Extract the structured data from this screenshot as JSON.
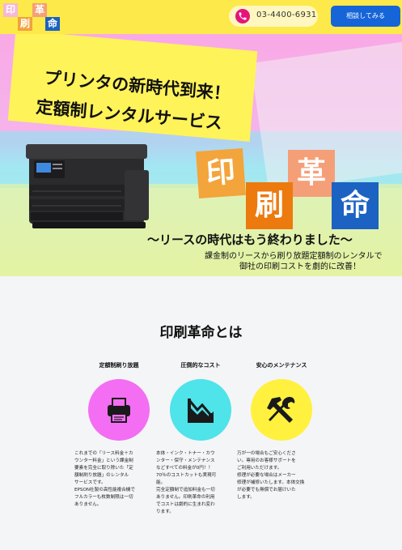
{
  "header": {
    "logo": {
      "chars": [
        "印",
        "革",
        "刷",
        "命"
      ],
      "colors": [
        "#f5b8d8",
        "#f59f78",
        "#f1a23b",
        "#1b62c2"
      ]
    },
    "phone": {
      "number": "03-4400-6931",
      "icon": "phone-icon"
    },
    "contact_label": "相談してみる"
  },
  "hero": {
    "title_line1": "プリンタの新時代到来！",
    "title_line2": "定額制レンタルサービス",
    "tiles": [
      "印",
      "革",
      "刷",
      "命"
    ],
    "tile_colors": [
      "#f3a43b",
      "#f59f78",
      "#ec7a0e",
      "#1b62c2"
    ],
    "tagline": "〜リースの時代はもう終わりました〜",
    "desc_line1": "課金制のリースから刷り放題定額制のレンタルで",
    "desc_line2": "御社の印刷コストを劇的に改善！"
  },
  "about": {
    "title": "印刷革命とは",
    "features": [
      {
        "title": "定額制刷り放題",
        "icon": "printer-icon",
        "color": "#f36ef3",
        "text": [
          "これまでの「リース料金＋カ",
          "ウンター料金」という課金制",
          "要素を完全に取り除いた「定",
          "額制刷り放題」のレンタル",
          "サービスです。",
          "EPSON社製の高性能複合機で",
          "フルカラーも枚数制限は一切",
          "ありません。"
        ]
      },
      {
        "title": "圧倒的なコスト",
        "icon": "cost-down-chart-icon",
        "color": "#4fe3ea",
        "text": [
          "本体・インク・トナー・カウ",
          "ンター・保守・メンテナンス",
          "などすべての料金が0円！！",
          "70％のコストカットも実現可",
          "能。",
          "完全定額制で追加料金も一切",
          "ありません。印刷革命の利用",
          "でコストは劇的に生まれ変わ",
          "ります。"
        ]
      },
      {
        "title": "安心のメンテナンス",
        "icon": "tools-icon",
        "color": "#fff13e",
        "text": [
          "万が一の場合もご安心くださ",
          "い。専用のお客様サポートを",
          "ご利用いただけます。",
          "修理が必要な場合はメーカー",
          "修理が補修いたします。本体交換",
          "が必要でも無償でお届けいた",
          "します。"
        ]
      }
    ]
  }
}
